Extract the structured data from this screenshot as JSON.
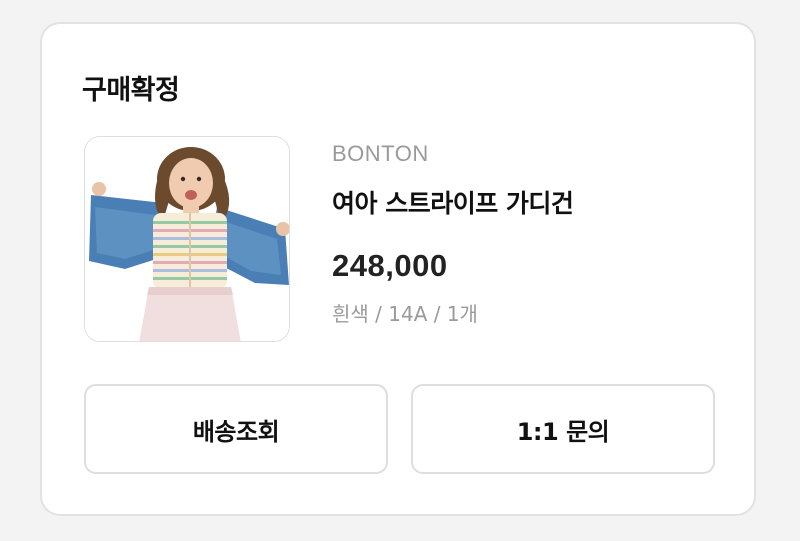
{
  "order": {
    "status_title": "구매확정",
    "product": {
      "image_alt": "여아 스트라이프 가디건 product photo",
      "brand": "BONTON",
      "name": "여아 스트라이프 가디건",
      "price": "248,000",
      "options": "흰색 / 14A / 1개"
    },
    "actions": {
      "track_delivery_label": "배송조회",
      "inquiry_label": "1:1 문의"
    }
  }
}
